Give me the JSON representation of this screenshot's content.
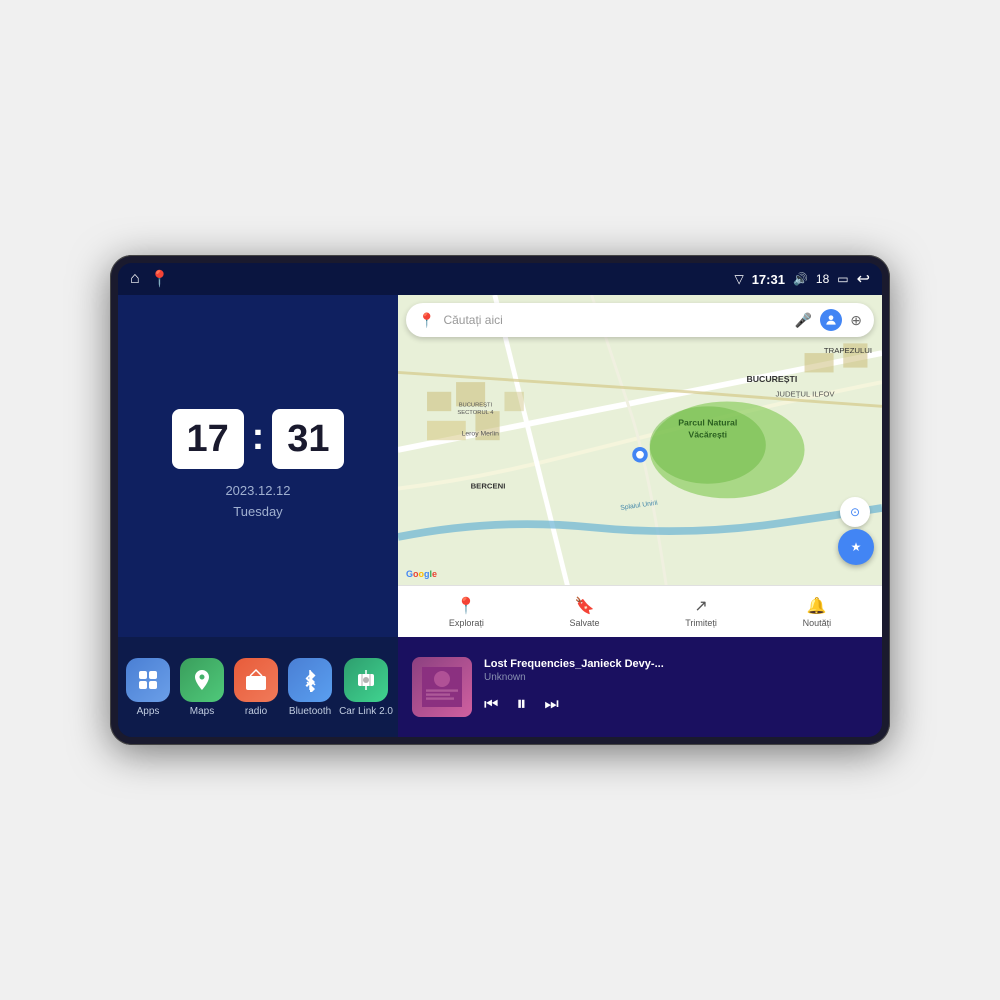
{
  "device": {
    "status_bar": {
      "left_icons": [
        "home-icon",
        "maps-pin-icon"
      ],
      "signal_icon": "▽",
      "time": "17:31",
      "volume_icon": "🔊",
      "volume_level": "18",
      "battery_icon": "🔋",
      "back_icon": "↩"
    },
    "clock": {
      "hours": "17",
      "minutes": "31",
      "date": "2023.12.12",
      "day": "Tuesday"
    },
    "apps": [
      {
        "id": "apps",
        "label": "Apps",
        "icon": "⊞",
        "class": "app-icon-apps"
      },
      {
        "id": "maps",
        "label": "Maps",
        "icon": "📍",
        "class": "app-icon-maps"
      },
      {
        "id": "radio",
        "label": "radio",
        "icon": "📻",
        "class": "app-icon-radio"
      },
      {
        "id": "bluetooth",
        "label": "Bluetooth",
        "icon": "⦿",
        "class": "app-icon-bluetooth"
      },
      {
        "id": "carlink",
        "label": "Car Link 2.0",
        "icon": "📱",
        "class": "app-icon-carlink"
      }
    ],
    "map": {
      "search_placeholder": "Căutați aici",
      "nav_items": [
        {
          "id": "explore",
          "icon": "📍",
          "label": "Explorați"
        },
        {
          "id": "saved",
          "icon": "🔖",
          "label": "Salvate"
        },
        {
          "id": "share",
          "icon": "↗",
          "label": "Trimiteți"
        },
        {
          "id": "news",
          "icon": "🔔",
          "label": "Noutăți"
        }
      ],
      "locations": [
        "TRAPEZULUI",
        "BUCUREȘTI",
        "JUDEȚUL ILFOV",
        "BERCENI"
      ],
      "pois": [
        "Parcul Natural Văcărești",
        "Leroy Merlin",
        "BUCUREȘTI SECTORUL 4"
      ]
    },
    "music": {
      "title": "Lost Frequencies_Janieck Devy-...",
      "artist": "Unknown",
      "controls": {
        "prev": "⏮",
        "play_pause": "⏸",
        "next": "⏭"
      }
    }
  }
}
